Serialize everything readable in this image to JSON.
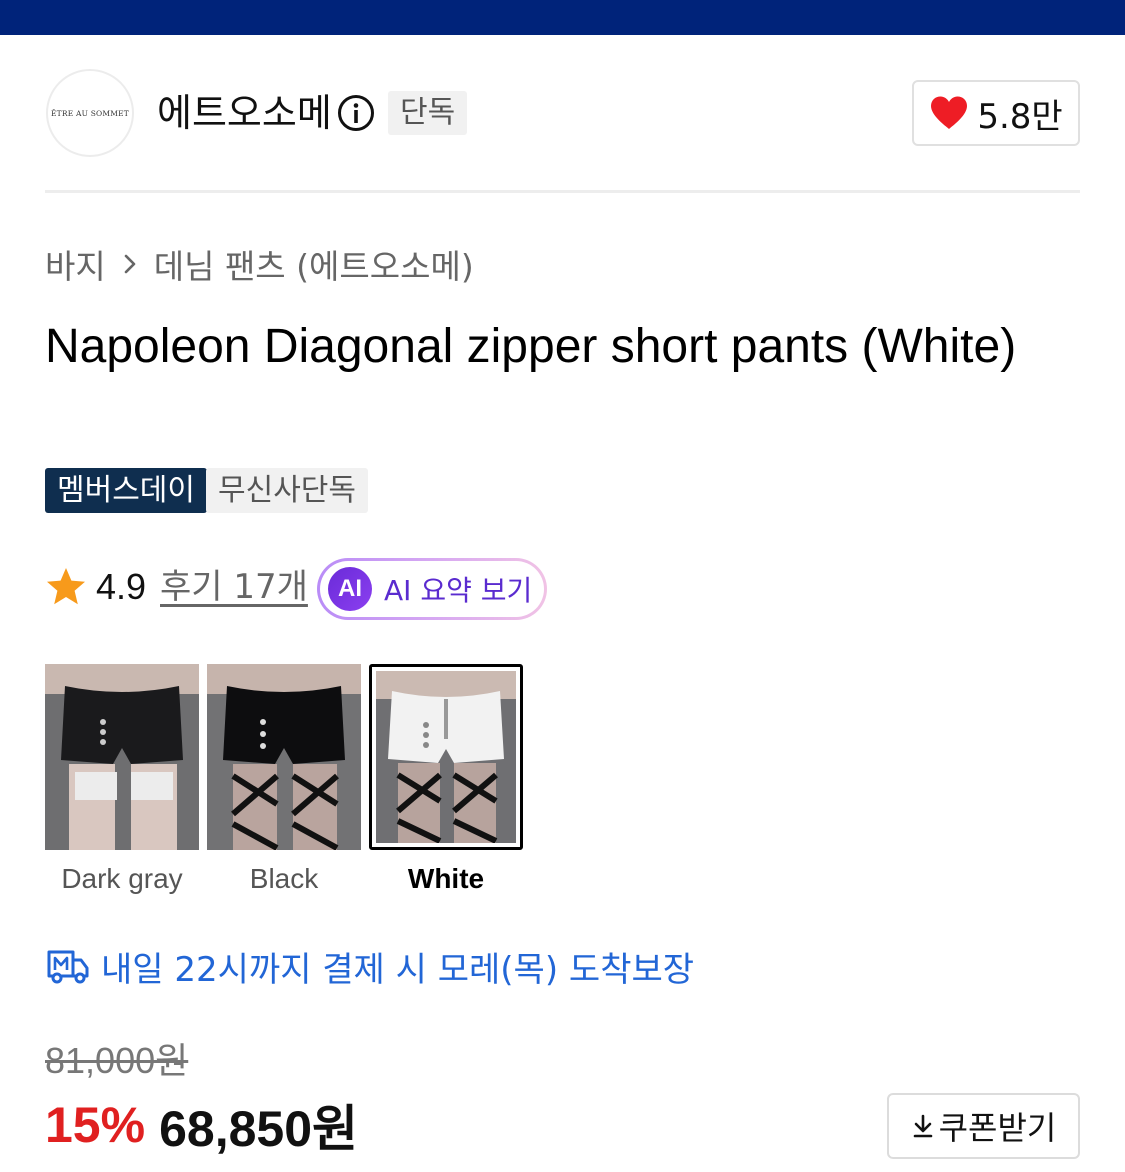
{
  "brand": {
    "logo_text": "ÊTRE AU SOMMET",
    "name": "에트오소메",
    "badge": "단독",
    "likes": "5.8만"
  },
  "breadcrumb": {
    "items": [
      "바지",
      "데님 팬츠 (에트오소메)"
    ]
  },
  "product": {
    "title": "Napoleon Diagonal zipper short pants (White)",
    "tags": [
      "멤버스데이",
      "무신사단독"
    ],
    "rating": "4.9",
    "reviews": "후기 17개",
    "ai_badge": "AI",
    "ai_summary_label": "AI 요약 보기"
  },
  "colors": {
    "options": [
      {
        "label": "Dark gray",
        "selected": false
      },
      {
        "label": "Black",
        "selected": false
      },
      {
        "label": "White",
        "selected": true
      }
    ]
  },
  "delivery": {
    "text": "내일 22시까지 결제 시 모레(목) 도착보장"
  },
  "price": {
    "original": "81,000원",
    "discount_rate": "15%",
    "sale": "68,850원",
    "coupon_label": "쿠폰받기"
  },
  "theme": {
    "header_bg": "#00237a",
    "accent_red": "#e02020",
    "delivery_blue": "#2266d6",
    "members_tag_bg": "#0f2e4f",
    "ai_purple": "#5a2bcf"
  }
}
